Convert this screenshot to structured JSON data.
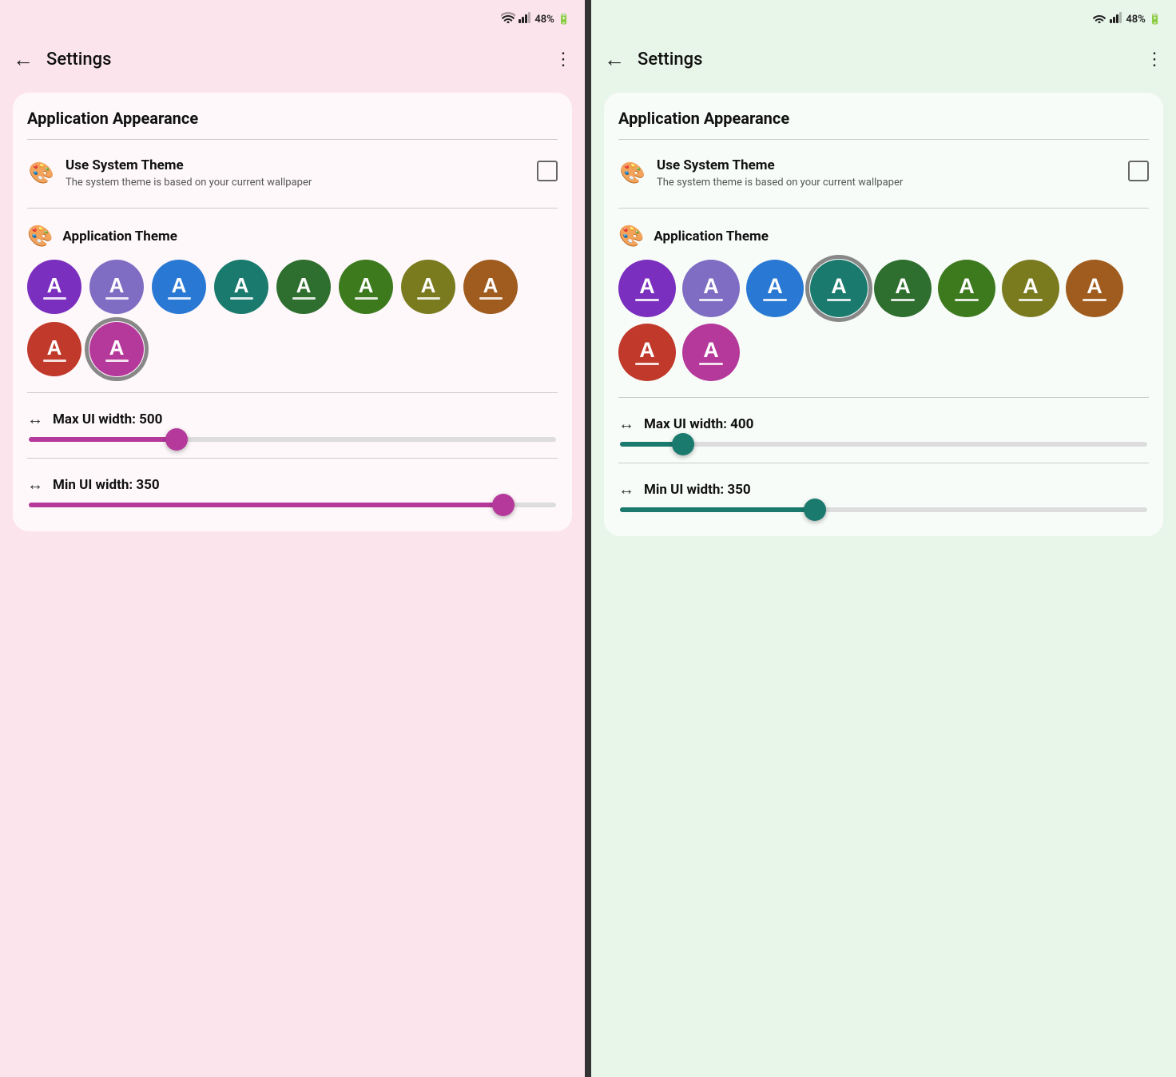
{
  "left": {
    "statusBar": {
      "wifi": "wifi",
      "signal": "signal",
      "battery": "48%"
    },
    "appBar": {
      "backLabel": "←",
      "title": "Settings",
      "moreLabel": "⋮"
    },
    "card": {
      "title": "Application Appearance",
      "systemTheme": {
        "title": "Use System Theme",
        "description": "The system theme is based on your current wallpaper",
        "checked": false
      },
      "appTheme": {
        "title": "Application Theme"
      },
      "colors": [
        {
          "id": "purple",
          "hex": "#7B2FBE",
          "selected": false
        },
        {
          "id": "lavender",
          "hex": "#7E6DC3",
          "selected": false
        },
        {
          "id": "blue",
          "hex": "#2979D4",
          "selected": false
        },
        {
          "id": "teal-dark",
          "hex": "#1A7A6E",
          "selected": false
        },
        {
          "id": "green-dark",
          "hex": "#2E6E2E",
          "selected": false
        },
        {
          "id": "olive-green",
          "hex": "#3D7A1E",
          "selected": false
        },
        {
          "id": "olive",
          "hex": "#7A7A1E",
          "selected": false
        },
        {
          "id": "brown-orange",
          "hex": "#A05C1E",
          "selected": false
        },
        {
          "id": "red",
          "hex": "#C0392B",
          "selected": false
        },
        {
          "id": "magenta",
          "hex": "#B5399B",
          "selected": true
        }
      ],
      "maxUIWidth": {
        "label": "Max UI width: 500",
        "value": 500,
        "min": 300,
        "max": 800,
        "percent": 28,
        "color": "#B5399B"
      },
      "minUIWidth": {
        "label": "Min UI width: 350",
        "value": 350,
        "min": 200,
        "max": 600,
        "percent": 90,
        "color": "#B5399B"
      }
    }
  },
  "right": {
    "statusBar": {
      "wifi": "wifi",
      "signal": "signal",
      "battery": "48%"
    },
    "appBar": {
      "backLabel": "←",
      "title": "Settings",
      "moreLabel": "⋮"
    },
    "card": {
      "title": "Application Appearance",
      "systemTheme": {
        "title": "Use System Theme",
        "description": "The system theme is based on your current wallpaper",
        "checked": false
      },
      "appTheme": {
        "title": "Application Theme"
      },
      "colors": [
        {
          "id": "purple",
          "hex": "#7B2FBE",
          "selected": false
        },
        {
          "id": "lavender",
          "hex": "#7E6DC3",
          "selected": false
        },
        {
          "id": "blue",
          "hex": "#2979D4",
          "selected": false
        },
        {
          "id": "teal-dark",
          "hex": "#1A7A6E",
          "selected": true
        },
        {
          "id": "green-dark",
          "hex": "#2E6E2E",
          "selected": false
        },
        {
          "id": "olive-green",
          "hex": "#3D7A1E",
          "selected": false
        },
        {
          "id": "olive",
          "hex": "#7A7A1E",
          "selected": false
        },
        {
          "id": "brown-orange",
          "hex": "#A05C1E",
          "selected": false
        },
        {
          "id": "red",
          "hex": "#C0392B",
          "selected": false
        },
        {
          "id": "magenta",
          "hex": "#B5399B",
          "selected": false
        }
      ],
      "maxUIWidth": {
        "label": "Max UI width: 400",
        "value": 400,
        "min": 300,
        "max": 800,
        "percent": 12,
        "color": "#1A7A6E"
      },
      "minUIWidth": {
        "label": "Min UI width: 350",
        "value": 350,
        "min": 200,
        "max": 600,
        "percent": 37,
        "color": "#1A7A6E"
      }
    }
  },
  "icons": {
    "palette": "🎨",
    "arrows": "↔"
  }
}
